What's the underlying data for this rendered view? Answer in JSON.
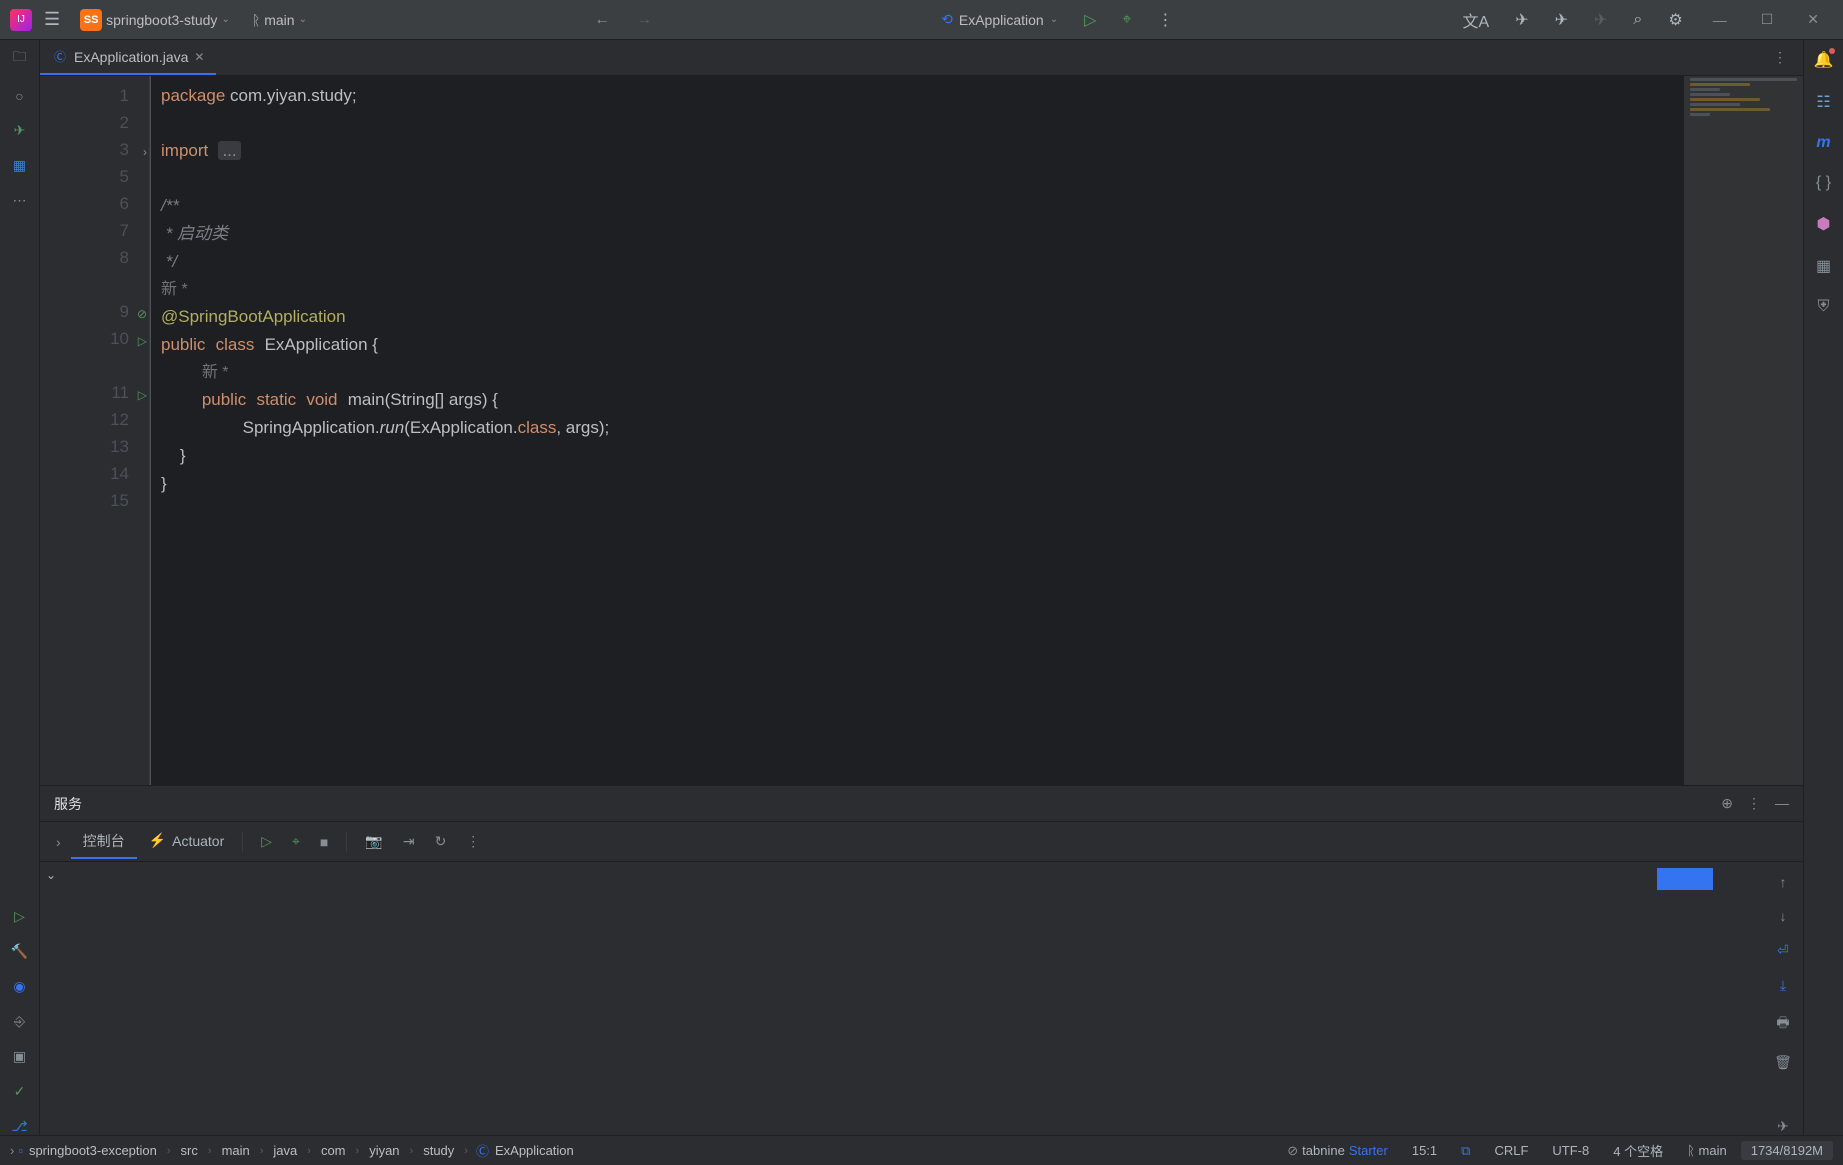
{
  "toolbar": {
    "project_name": "springboot3-study",
    "project_badge": "SS",
    "branch": "main",
    "run_config": "ExApplication"
  },
  "tab": {
    "filename": "ExApplication.java"
  },
  "editor": {
    "line_numbers": [
      "1",
      "2",
      "3",
      "5",
      "6",
      "7",
      "8",
      "",
      "9",
      "10",
      "",
      "11",
      "12",
      "13",
      "14",
      "15"
    ],
    "pkg_kw": "package",
    "pkg_val": " com.yiyan.study;",
    "import_kw": "import",
    "import_fold": "...",
    "doc_start": "/**",
    "doc_line": " * 启动类",
    "doc_end": " */",
    "hint1": "新 *",
    "annotation": "@SpringBootApplication",
    "public_kw": "public",
    "class_kw": "class",
    "class_name": "ExApplication",
    "brace_open": " {",
    "hint2": "新 *",
    "static_kw": "static",
    "void_kw": "void",
    "main_name": "main",
    "main_sig_open": "(String[] args) {",
    "spring_app": "SpringApplication.",
    "run_m": "run",
    "run_args_open": "(ExApplication.",
    "class_kw2": "class",
    "run_args_close": ", args);",
    "brace_close_inner": "    }",
    "brace_close_outer": "}"
  },
  "services": {
    "title": "服务",
    "tab_console": "控制台",
    "tab_actuator": "Actuator"
  },
  "breadcrumbs": [
    "springboot3-exception",
    "src",
    "main",
    "java",
    "com",
    "yiyan",
    "study",
    "ExApplication"
  ],
  "status": {
    "tabnine": "tabnine",
    "tabnine_tier": "Starter",
    "cursor": "15:1",
    "line_sep": "CRLF",
    "encoding": "UTF-8",
    "indent": "4 个空格",
    "branch": "main",
    "memory": "1734/8192M"
  }
}
